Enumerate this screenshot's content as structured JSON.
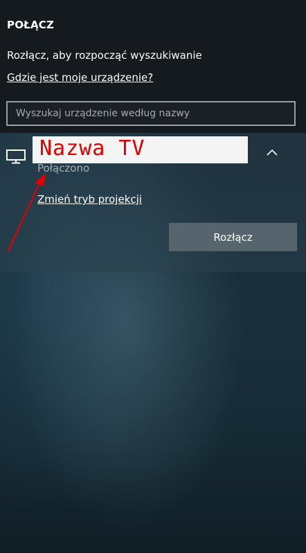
{
  "panel": {
    "title": "POŁĄCZ",
    "hint": "Rozłącz, aby rozpocząć wyszukiwanie",
    "where_link": "Gdzie jest moje urządzenie?"
  },
  "search": {
    "placeholder": "Wyszukaj urządzenie według nazwy",
    "value": ""
  },
  "device": {
    "icon": "monitor-icon",
    "name": "Nazwa TV",
    "status": "Połączono",
    "change_mode_link": "Zmień tryb projekcji",
    "disconnect_label": "Rozłącz",
    "expand_icon": "chevron-up-icon"
  },
  "annotation": {
    "color": "#e00000",
    "arrow": "arrow-annotation"
  }
}
